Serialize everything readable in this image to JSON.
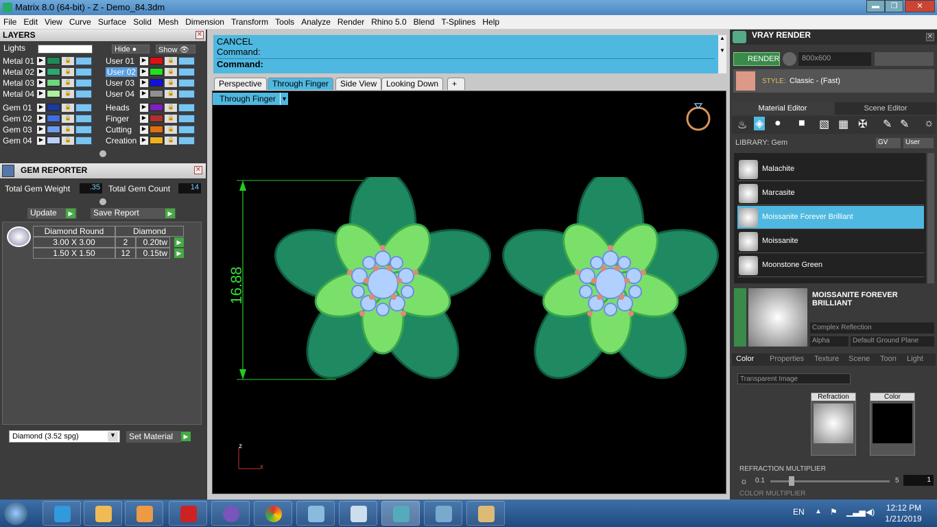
{
  "window": {
    "title": "Matrix 8.0 (64-bit) - Z - Demo_84.3dm",
    "min": "▬",
    "max": "❐",
    "close": "✕"
  },
  "menu": [
    "File",
    "Edit",
    "View",
    "Curve",
    "Surface",
    "Solid",
    "Mesh",
    "Dimension",
    "Transform",
    "Tools",
    "Analyze",
    "Render",
    "Rhino 5.0",
    "Blend",
    "T-Splines",
    "Help"
  ],
  "layers": {
    "title": "LAYERS",
    "lights": "Lights",
    "hide": "Hide",
    "show": "Show",
    "left": [
      {
        "name": "Metal 01",
        "color": "#1e8a5a"
      },
      {
        "name": "Metal 02",
        "color": "#2ba870"
      },
      {
        "name": "Metal 03",
        "color": "#6cd87a"
      },
      {
        "name": "Metal 04",
        "color": "#aef0a0"
      },
      {
        "name": "Gem 01",
        "color": "#1a3aa0"
      },
      {
        "name": "Gem 02",
        "color": "#3f6ee0"
      },
      {
        "name": "Gem 03",
        "color": "#6e9cf0"
      },
      {
        "name": "Gem 04",
        "color": "#b8d0f8"
      }
    ],
    "right": [
      {
        "name": "User 01",
        "color": "#e01010"
      },
      {
        "name": "User 02",
        "color": "#20e020"
      },
      {
        "name": "User 03",
        "color": "#1010e0"
      },
      {
        "name": "User 04",
        "color": "#909090"
      },
      {
        "name": "Heads",
        "color": "#8020c0"
      },
      {
        "name": "Finger",
        "color": "#b03030"
      },
      {
        "name": "Cutting",
        "color": "#e07010"
      },
      {
        "name": "Creation",
        "color": "#f0b020"
      }
    ]
  },
  "gem": {
    "title": "GEM REPORTER",
    "weight_label": "Total Gem Weight",
    "weight": ".35",
    "count_label": "Total Gem Count",
    "count": "14",
    "update": "Update",
    "save": "Save Report",
    "col1": "Diamond Round",
    "col2": "Diamond",
    "rows": [
      {
        "size": "3.00 X 3.00",
        "qty": "2",
        "tw": "0.20tw"
      },
      {
        "size": "1.50 X 1.50",
        "qty": "12",
        "tw": "0.15tw"
      }
    ],
    "material": "Diamond    (3.52 spg)",
    "set_material": "Set Material"
  },
  "command": {
    "l1": "CANCEL",
    "l2": "Command:",
    "l3": "Command:"
  },
  "tabs": [
    "Perspective",
    "Through Finger",
    "Side View",
    "Looking Down",
    "+"
  ],
  "viewport": {
    "label": "Through Finger",
    "dimension": "16.88",
    "axis_z": "z",
    "axis_x": "x"
  },
  "vray": {
    "title": "VRAY RENDER",
    "render": "RENDER",
    "resolution": "800x600",
    "style_label": "STYLE:",
    "style": "Classic - (Fast)",
    "tab1": "Material Editor",
    "tab2": "Scene Editor",
    "library": "LIBRARY: Gem",
    "gv": "GV",
    "user": "User",
    "materials": [
      "Malachite",
      "Marcasite",
      "Moissanite Forever Brilliant",
      "Moissanite",
      "Moonstone Green"
    ],
    "selected_name": "MOISSANITE FOREVER BRILLIANT",
    "reflection": "Complex Reflection",
    "alpha": "Alpha",
    "ground": "Default Ground Plane",
    "subtabs": [
      "Color",
      "Properties",
      "Texture",
      "Scene",
      "Toon",
      "Light"
    ],
    "transparent": "Transparent Image",
    "refraction": "Refraction",
    "color": "Color",
    "mult_label": "REFRACTION MULTIPLIER",
    "mult_min": "0.1",
    "mult_max": "5",
    "mult_val": "1",
    "color_mult": "COLOR MULTIPLIER"
  },
  "taskbar": {
    "lang": "EN",
    "time": "12:12 PM",
    "date": "1/21/2019"
  }
}
